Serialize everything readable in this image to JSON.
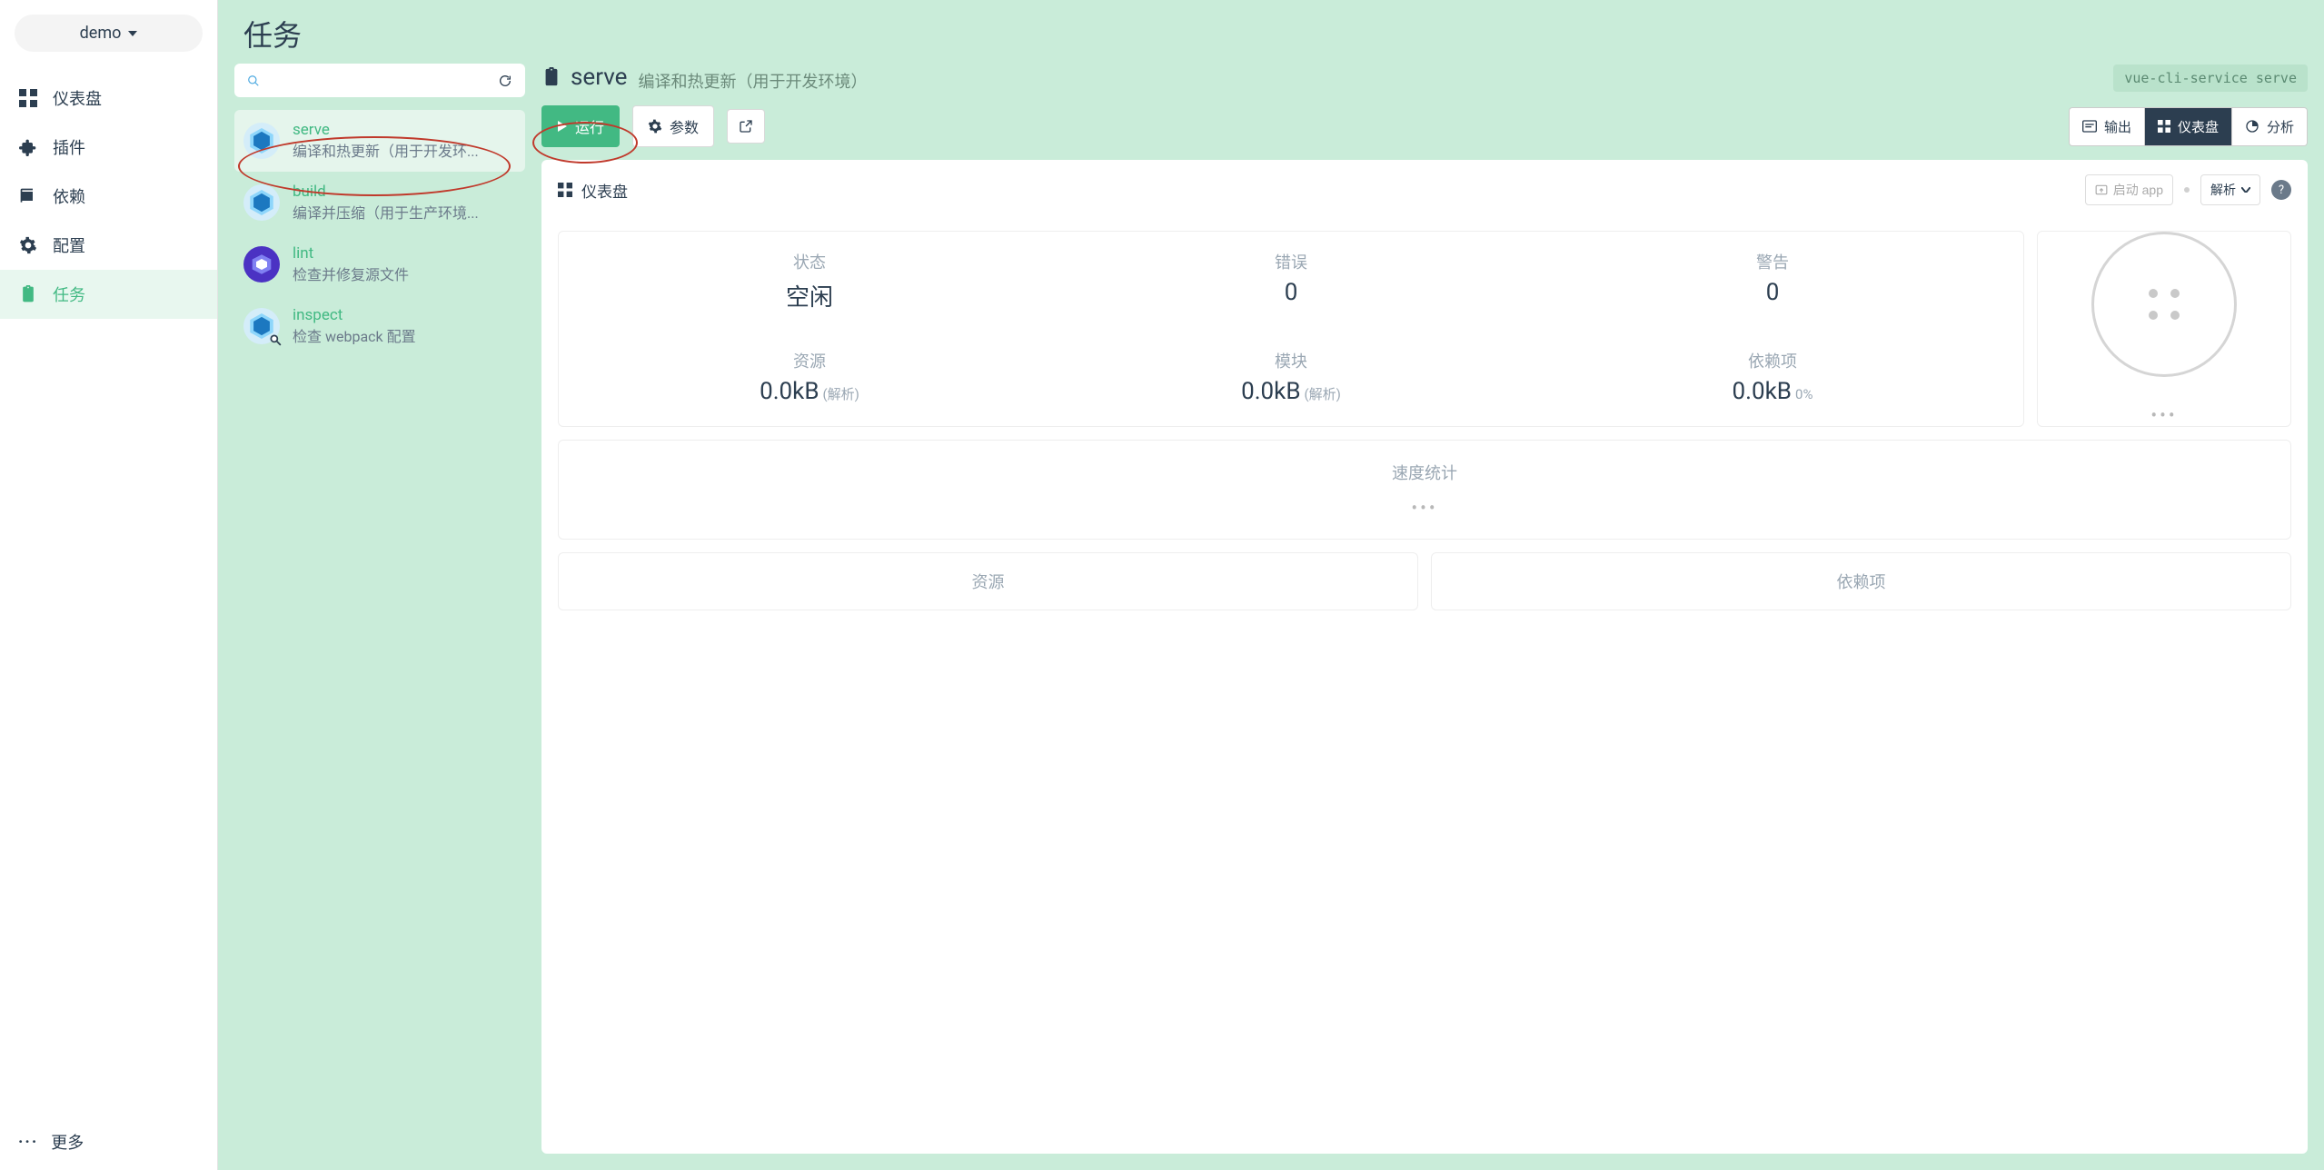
{
  "project": {
    "name": "demo"
  },
  "nav": {
    "dashboard": "仪表盘",
    "plugins": "插件",
    "deps": "依赖",
    "config": "配置",
    "tasks": "任务",
    "more": "更多"
  },
  "page": {
    "title": "任务"
  },
  "search": {
    "placeholder": ""
  },
  "tasks": [
    {
      "name": "serve",
      "desc": "编译和热更新（用于开发环...",
      "icon": "webpack"
    },
    {
      "name": "build",
      "desc": "编译并压缩（用于生产环境...",
      "icon": "webpack"
    },
    {
      "name": "lint",
      "desc": "检查并修复源文件",
      "icon": "eslint"
    },
    {
      "name": "inspect",
      "desc": "检查 webpack 配置",
      "icon": "webpack-search"
    }
  ],
  "detail": {
    "title": "serve",
    "subtitle": "编译和热更新（用于开发环境）",
    "command": "vue-cli-service serve",
    "run": "运行",
    "params": "参数",
    "views": {
      "output": "输出",
      "dashboard": "仪表盘",
      "analyze": "分析"
    }
  },
  "dashboard": {
    "title": "仪表盘",
    "launch": "启动 app",
    "parseSelect": "解析",
    "stats": {
      "status": {
        "label": "状态",
        "value": "空闲"
      },
      "errors": {
        "label": "错误",
        "value": "0"
      },
      "warnings": {
        "label": "警告",
        "value": "0"
      },
      "assets": {
        "label": "资源",
        "value": "0.0kB",
        "sub": "(解析)"
      },
      "modules": {
        "label": "模块",
        "value": "0.0kB",
        "sub": "(解析)"
      },
      "deps": {
        "label": "依赖项",
        "value": "0.0kB",
        "sub": "0%"
      }
    },
    "speed": {
      "title": "速度统计"
    },
    "bottom": {
      "assets": "资源",
      "deps": "依赖项"
    }
  }
}
